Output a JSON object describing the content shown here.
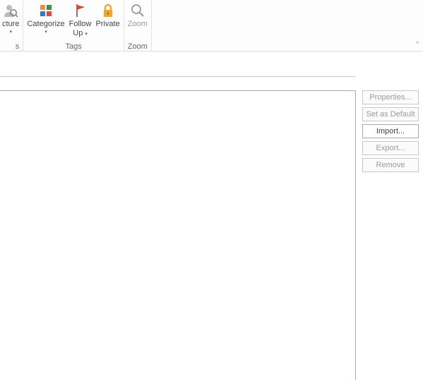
{
  "ribbon": {
    "picture_btn": "cture",
    "categorize": "Categorize",
    "followup_line1": "Follow",
    "followup_line2": "Up",
    "private": "Private",
    "zoom": "Zoom",
    "group_tags": "Tags",
    "group_zoom": "Zoom"
  },
  "side": {
    "properties": "Properties...",
    "set_default": "Set as Default",
    "import": "Import...",
    "export": "Export...",
    "remove": "Remove"
  }
}
